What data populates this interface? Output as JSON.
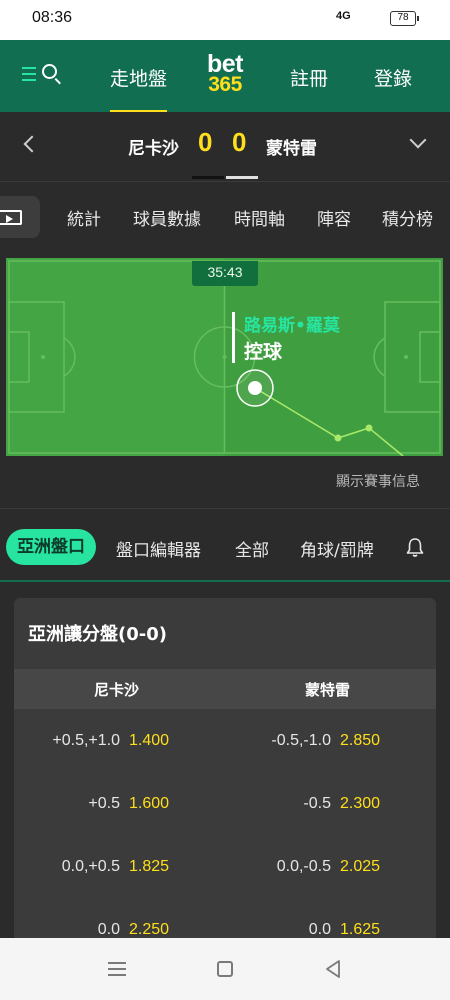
{
  "status": {
    "time": "08:36",
    "signal": "4G",
    "battery": "78"
  },
  "nav": {
    "in_play": "走地盤",
    "logo_top": "bet",
    "logo_bottom": "365",
    "register": "註冊",
    "login": "登錄"
  },
  "match": {
    "home": "尼卡沙",
    "home_score": "0",
    "away_score": "0",
    "away": "蒙特雷"
  },
  "tabs": [
    "統計",
    "球員數據",
    "時間軸",
    "陣容",
    "積分榜"
  ],
  "pitch": {
    "time": "35:43",
    "player": "路易斯•羅莫",
    "action": "控球"
  },
  "show_info": "顯示賽事信息",
  "market_tabs": {
    "active": "亞洲盤口",
    "items": [
      "盤口編輯器",
      "全部",
      "角球/罰牌"
    ]
  },
  "market": {
    "title": "亞洲讓分盤(0-0)",
    "home": "尼卡沙",
    "away": "蒙特雷",
    "rows": [
      {
        "home_line": "+0.5,+1.0",
        "home_odds": "1.400",
        "away_line": "-0.5,-1.0",
        "away_odds": "2.850"
      },
      {
        "home_line": "+0.5",
        "home_odds": "1.600",
        "away_line": "-0.5",
        "away_odds": "2.300"
      },
      {
        "home_line": "0.0,+0.5",
        "home_odds": "1.825",
        "away_line": "0.0,-0.5",
        "away_odds": "2.025"
      },
      {
        "home_line": "0.0",
        "home_odds": "2.250",
        "away_line": "0.0",
        "away_odds": "1.625"
      }
    ]
  },
  "colors": {
    "brand_green": "#126e51",
    "accent_green": "#27e4a1",
    "odds_yellow": "#ffdf1b",
    "pitch_green": "#3f9e3f"
  }
}
